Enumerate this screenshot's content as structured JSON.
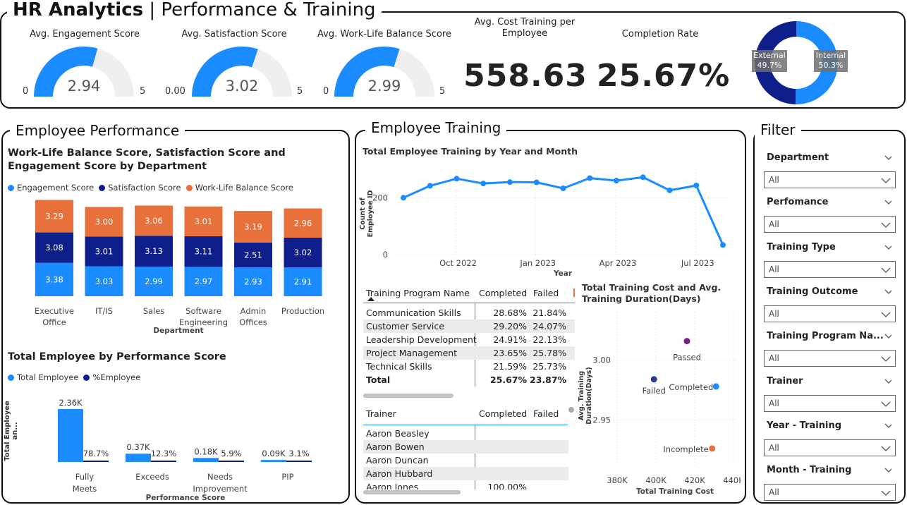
{
  "header": {
    "title_bold": "HR Analytics",
    "title_sep": " | ",
    "title_rest": "Performance & Training"
  },
  "kpis": {
    "gauges": [
      {
        "label": "Avg. Engagement Score",
        "value": "2.94",
        "min": "0",
        "max": "5",
        "fraction": 0.588
      },
      {
        "label": "Avg. Satisfaction Score",
        "value": "3.02",
        "min": "0.00",
        "max": "5",
        "fraction": 0.604
      },
      {
        "label": "Avg. Work-Life Balance Score",
        "value": "2.99",
        "min": "0",
        "max": "5",
        "fraction": 0.598
      }
    ],
    "cost": {
      "label": "Avg. Cost Training per Employee",
      "value": "558.63"
    },
    "completion": {
      "label": "Completion Rate",
      "value": "25.67%"
    },
    "donut": {
      "slices": [
        {
          "name": "External",
          "pct": "49.7%",
          "value": 49.7,
          "color": "#0e1f8c"
        },
        {
          "name": "Internal",
          "pct": "50.3%",
          "value": 50.3,
          "color": "#1a8cff"
        }
      ]
    }
  },
  "colors": {
    "engagement": "#1a8cff",
    "satisfaction": "#0e1f8c",
    "worklife": "#e8703a",
    "purple": "#7b1f86",
    "trackgray": "#efefef"
  },
  "performance": {
    "section_title": "Employee Performance",
    "chart1_title": "Work-Life Balance Score, Satisfaction Score and Engagement Score by Department",
    "chart1_legend": [
      "Engagement Score",
      "Satisfaction Score",
      "Work-Life Balance Score"
    ],
    "chart1_xlabel": "Department",
    "chart2_title": "Total Employee by Performance Score",
    "chart2_legend": [
      "Total Employee",
      "%Employee"
    ],
    "chart2_ylabel": "Total Employee an...",
    "chart2_xlabel": "Performance Score"
  },
  "training": {
    "section_title": "Employee Training",
    "line_title": "Total Employee Training by Year and Month",
    "line_ylabel": "Count of Employee ID",
    "line_xlabel": "Year",
    "program_table": {
      "headers": [
        "Training Program Name",
        "Completed",
        "Failed"
      ],
      "rows": [
        [
          "Communication Skills",
          "28.68%",
          "21.84%"
        ],
        [
          "Customer Service",
          "29.20%",
          "24.07%"
        ],
        [
          "Leadership Development",
          "24.91%",
          "22.13%"
        ],
        [
          "Project Management",
          "23.65%",
          "25.78%"
        ],
        [
          "Technical Skills",
          "21.59%",
          "25.73%"
        ]
      ],
      "total": [
        "Total",
        "25.67%",
        "23.87%"
      ]
    },
    "trainer_table": {
      "headers": [
        "Trainer",
        "Completed",
        "Failed"
      ],
      "rows": [
        [
          "Aaron Beasley",
          "",
          ""
        ],
        [
          "Aaron Bowen",
          "",
          ""
        ],
        [
          "Aaron Duncan",
          "",
          ""
        ],
        [
          "Aaron Hubbard",
          "",
          ""
        ],
        [
          "Aaron Jones",
          "100.00%",
          ""
        ]
      ]
    },
    "scatter_title": "Total Training Cost and Avg. Training Duration(Days)",
    "scatter_ylabel": "Avg. Training Duration(Days)",
    "scatter_xlabel": "Total Training Cost"
  },
  "filter": {
    "section_title": "Filter",
    "items": [
      {
        "label": "Department",
        "value": "All"
      },
      {
        "label": "Perfomance",
        "value": "All"
      },
      {
        "label": "Training Type",
        "value": "All"
      },
      {
        "label": "Training Outcome",
        "value": "All"
      },
      {
        "label": "Training Program Na...",
        "value": "All"
      },
      {
        "label": "Trainer",
        "value": "All"
      },
      {
        "label": "Year - Training",
        "value": "All"
      },
      {
        "label": "Month - Training",
        "value": "All"
      }
    ]
  },
  "chart_data": [
    {
      "type": "bar",
      "stacked": true,
      "title": "Work-Life Balance Score, Satisfaction Score and Engagement Score by Department",
      "categories": [
        "Executive Office",
        "IT/IS",
        "Sales",
        "Software Engineering",
        "Admin Offices",
        "Production"
      ],
      "series": [
        {
          "name": "Engagement Score",
          "values": [
            3.38,
            3.03,
            2.99,
            2.97,
            2.93,
            2.91
          ]
        },
        {
          "name": "Satisfaction Score",
          "values": [
            3.08,
            3.01,
            3.13,
            3.11,
            2.51,
            3.02
          ]
        },
        {
          "name": "Work-Life Balance Score",
          "values": [
            3.29,
            3.0,
            3.06,
            3.01,
            3.19,
            2.96
          ]
        }
      ],
      "xlabel": "Department",
      "legend": "top-left"
    },
    {
      "type": "bar",
      "title": "Total Employee by Performance Score",
      "categories": [
        "Fully Meets",
        "Exceeds",
        "Needs Improvement",
        "PIP"
      ],
      "series": [
        {
          "name": "Total Employee",
          "values": [
            2360,
            370,
            180,
            90
          ],
          "labels": [
            "2.36K",
            "0.37K",
            "0.18K",
            "0.09K"
          ]
        },
        {
          "name": "%Employee",
          "values": [
            78.7,
            12.3,
            5.9,
            3.1
          ],
          "labels": [
            "78.7%",
            "12.3%",
            "5.9%",
            "3.1%"
          ]
        }
      ],
      "xlabel": "Performance Score",
      "ylabel": "Total Employee an...",
      "legend": "top-left"
    },
    {
      "type": "line",
      "title": "Total Employee Training by Year and Month",
      "x": [
        "2022-08",
        "2022-09",
        "2022-10",
        "2022-11",
        "2022-12",
        "2023-01",
        "2023-02",
        "2023-03",
        "2023-04",
        "2023-05",
        "2023-06",
        "2023-07",
        "2023-08"
      ],
      "series": [
        {
          "name": "Count of Employee ID",
          "values": [
            200,
            242,
            267,
            250,
            255,
            254,
            233,
            269,
            260,
            272,
            226,
            243,
            34
          ]
        }
      ],
      "xticks": [
        "Oct 2022",
        "Jan 2023",
        "Apr 2023",
        "Jul 2023"
      ],
      "yticks": [
        "0",
        "200"
      ],
      "ylim": [
        0,
        300
      ],
      "xlabel": "Year",
      "ylabel": "Count of Employee ID",
      "grid": true
    },
    {
      "type": "scatter",
      "title": "Total Training Cost and Avg. Training Duration(Days)",
      "points": [
        {
          "label": "Passed",
          "x": 416000,
          "y": 3.016,
          "color": "#7b1f86"
        },
        {
          "label": "Failed",
          "x": 399000,
          "y": 2.984,
          "color": "#2a3a9c"
        },
        {
          "label": "Completed",
          "x": 431000,
          "y": 2.978,
          "color": "#1a8cff"
        },
        {
          "label": "Incomplete",
          "x": 429000,
          "y": 2.926,
          "color": "#e8703a"
        }
      ],
      "xticks": [
        "380K",
        "400K",
        "420K",
        "440K"
      ],
      "yticks": [
        "2.95",
        "3.00"
      ],
      "xlim": [
        380000,
        440000
      ],
      "ylim": [
        2.91,
        3.04
      ],
      "xlabel": "Total Training Cost",
      "ylabel": "Avg. Training Duration(Days)",
      "grid": true
    }
  ]
}
